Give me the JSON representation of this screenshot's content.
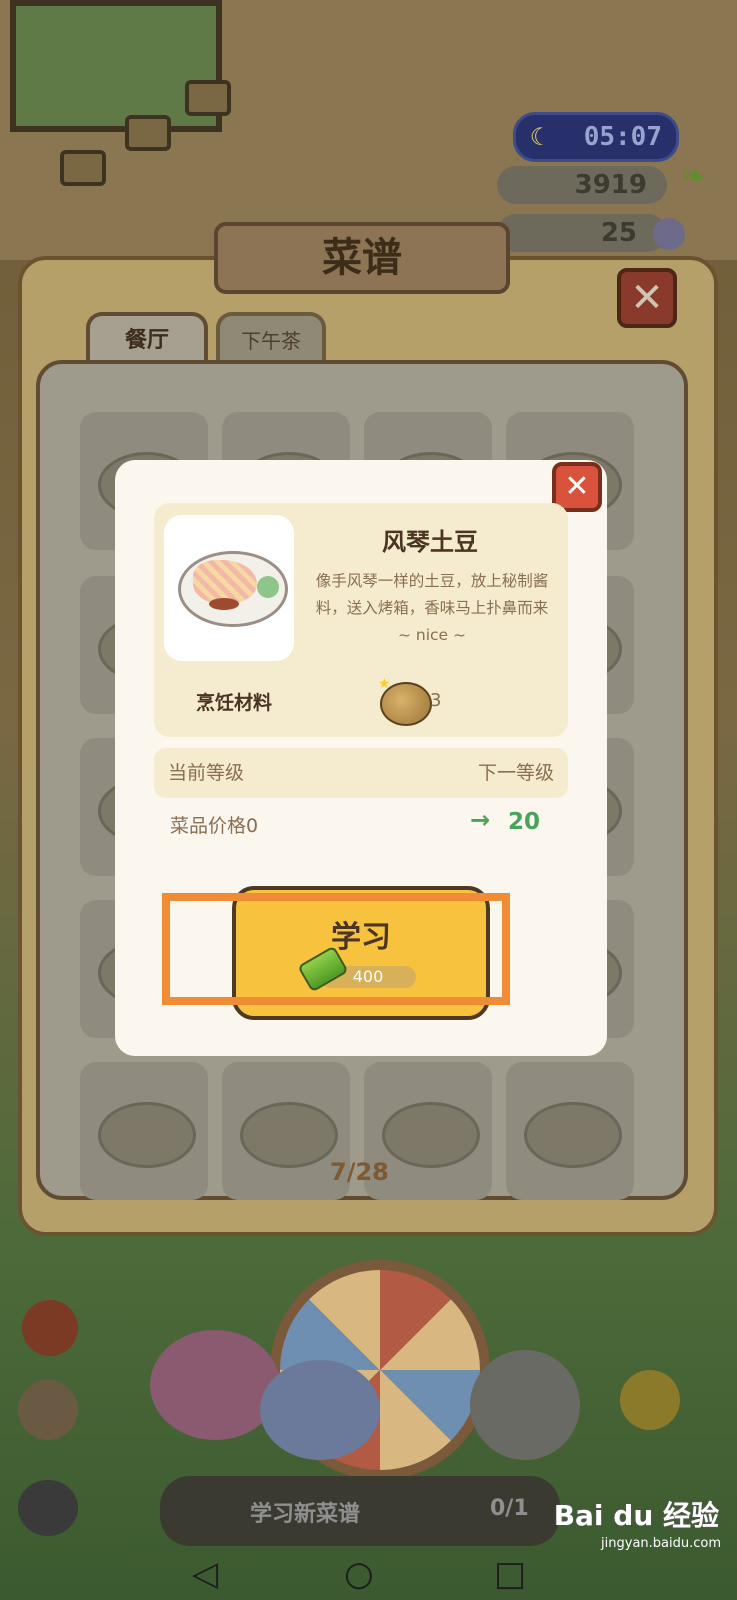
{
  "hud": {
    "time": "05:07",
    "money": "3919",
    "gems": "25"
  },
  "recipe_book": {
    "title": "菜谱",
    "close_icon": "close-icon",
    "tabs": [
      {
        "label": "餐厅",
        "active": true
      },
      {
        "label": "下午茶",
        "active": false
      }
    ],
    "page_count": "7/28"
  },
  "dialog": {
    "dish_name": "风琴土豆",
    "description": "像手风琴一样的土豆，放上秘制酱料，送入烤箱，香味马上扑鼻而来 ~ nice ~",
    "ingredients_label": "烹饪材料",
    "ingredient": {
      "icon": "potato-icon",
      "count": "3"
    },
    "current_level_label": "当前等级",
    "next_level_label": "下一等级",
    "price_label": "菜品价格0",
    "next_price": "20",
    "learn_button": {
      "label": "学习",
      "cost": "400",
      "icon": "bamboo-icon"
    }
  },
  "bottom_bar": {
    "label": "学习新菜谱",
    "count": "0/1"
  },
  "watermark": {
    "brand": "Bai du 经验",
    "url": "jingyan.baidu.com"
  },
  "colors": {
    "highlight": "#f08b36",
    "accent_green": "#4aa35a",
    "button_yellow": "#f7c33e"
  }
}
